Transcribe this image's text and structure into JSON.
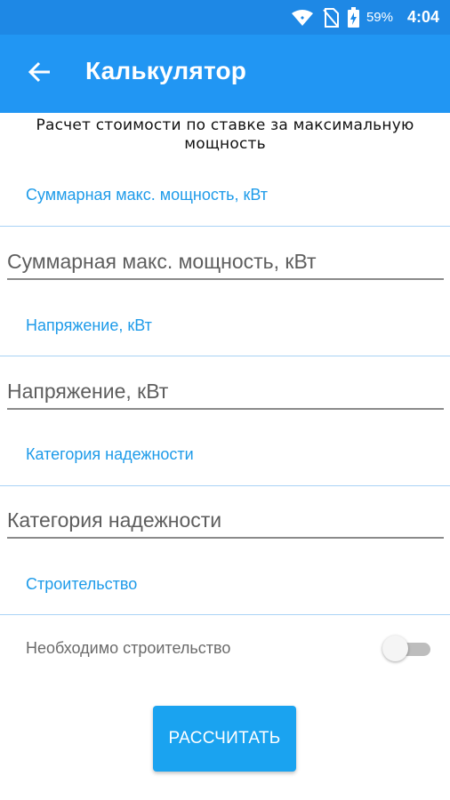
{
  "status_bar": {
    "battery_percent": "59%",
    "time": "4:04",
    "icons": [
      "wifi-icon",
      "no-sim-icon",
      "battery-charging-icon"
    ]
  },
  "app_bar": {
    "back_icon": "arrow-left-icon",
    "title": "Калькулятор"
  },
  "subtitle": "Расчет стоимости по ставке за максимальную мощность",
  "sections": {
    "power": {
      "label": "Суммарная макс. мощность, кВт",
      "placeholder": "Суммарная макс. мощность, кВт",
      "value": ""
    },
    "voltage": {
      "label": "Напряжение, кВт",
      "placeholder": "Напряжение, кВт",
      "value": ""
    },
    "reliability": {
      "label": "Категория надежности",
      "placeholder": "Категория надежности",
      "value": ""
    },
    "construction": {
      "label": "Строительство",
      "toggle_label": "Необходимо строительство",
      "toggle_on": false
    }
  },
  "calculate_button": "РАССЧИТАТЬ",
  "colors": {
    "status_bar": "#1e88e5",
    "app_bar": "#2196f3",
    "accent": "#1e9be9",
    "button": "#1aa3f0"
  }
}
